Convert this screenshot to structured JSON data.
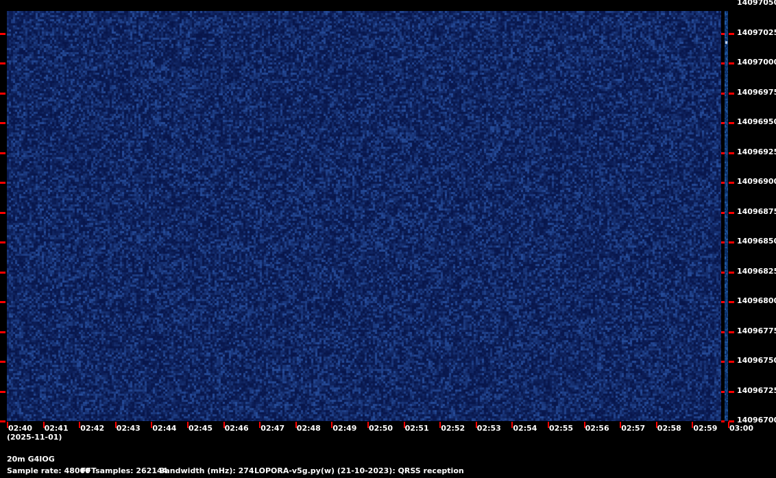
{
  "chart_data": {
    "type": "heatmap",
    "title": "",
    "xlabel": "",
    "ylabel": "",
    "date_label": "(2025-11-01)",
    "x_ticks": [
      "02:40",
      "02:41",
      "02:42",
      "02:43",
      "02:44",
      "02:45",
      "02:46",
      "02:47",
      "02:48",
      "02:49",
      "02:50",
      "02:51",
      "02:52",
      "02:53",
      "02:54",
      "02:55",
      "02:56",
      "02:57",
      "02:58",
      "02:59",
      "03:00"
    ],
    "y_ticks": [
      "14097050",
      "14097025",
      "14097000",
      "14096975",
      "14096950",
      "14096925",
      "14096900",
      "14096875",
      "14096850",
      "14096825",
      "14096800",
      "14096775",
      "14096750",
      "14096725",
      "14096700"
    ],
    "ylim": [
      14096700,
      14097050
    ],
    "colors": {
      "background": "#0c1a55",
      "noise_high": "#2a4a90",
      "tick": "#ff0000",
      "text": "#ffffff"
    },
    "grid": false
  },
  "footer": {
    "station": "20m G4IOG",
    "sample_rate": "Sample rate: 48000",
    "fft_samples": "FFTsamples: 262144",
    "bandwidth": "Bandwidth (mHz): 274",
    "software": "LOPORA-v5g.py(w) (21-10-2023): QRSS reception"
  }
}
